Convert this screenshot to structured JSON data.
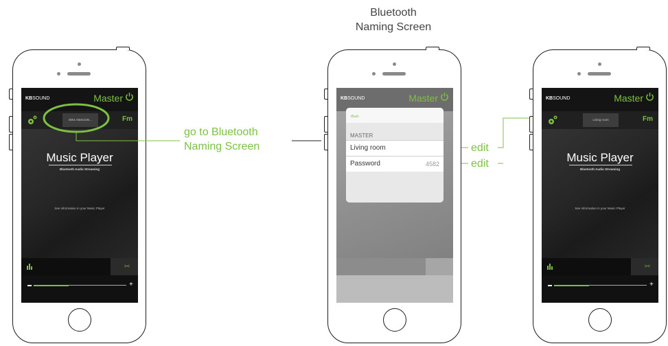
{
  "colors": {
    "accent": "#7dc142",
    "dark": "#1b1b1b"
  },
  "heading": {
    "line1": "Bluetooth",
    "line2": "Naming Screen"
  },
  "callouts": {
    "left": {
      "line1": "go to Bluetooth",
      "line2": "Naming Screen"
    },
    "edit1": "edit",
    "edit2": "edit"
  },
  "app": {
    "brand_bold": "KB",
    "brand_rest": "SOUND",
    "master_label": "Master",
    "fm_label": "Fm",
    "title": "Music Player",
    "subtitle": "Bluetooth Audio Streaming",
    "info": "See information in your Music Player",
    "icons": [
      "power-icon",
      "gear-icon",
      "equalizer-icon",
      "collapse-icon",
      "minus-icon",
      "plus-icon"
    ],
    "volume_fraction": 0.38
  },
  "phones": {
    "left": {
      "device_name": "0001 KBSOUN..."
    },
    "right": {
      "device_name": "Living room"
    }
  },
  "naming_dialog": {
    "back_label": "Back",
    "section_label": "MASTER",
    "name_value": "Living room",
    "password_label": "Password",
    "password_value": "4582"
  }
}
